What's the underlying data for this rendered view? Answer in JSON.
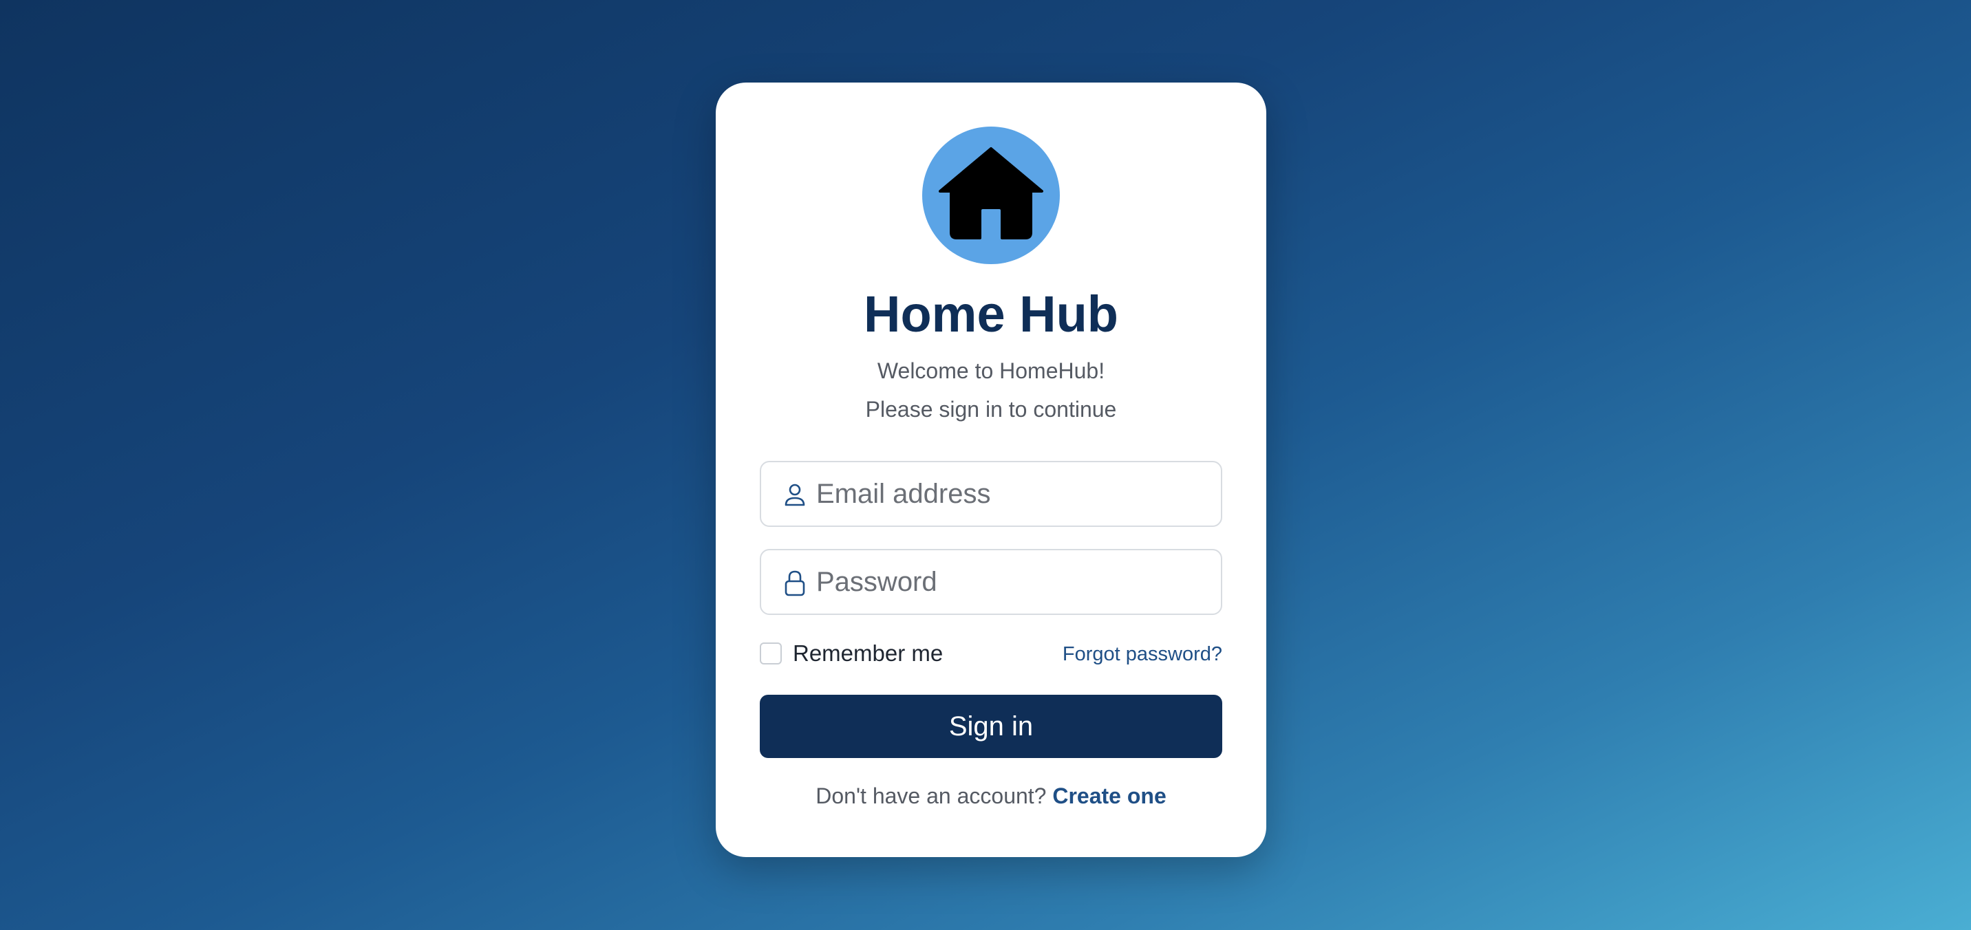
{
  "app": {
    "title": "Home Hub",
    "welcome": "Welcome to HomeHub!",
    "subtitle": "Please sign in to continue",
    "logo_icon": "house-icon",
    "logo_bg_color": "#5ba4e6"
  },
  "form": {
    "email": {
      "icon": "user-icon",
      "placeholder": "Email address",
      "value": ""
    },
    "password": {
      "icon": "lock-icon",
      "placeholder": "Password",
      "value": ""
    },
    "remember_label": "Remember me",
    "remember_checked": false,
    "forgot_label": "Forgot password?",
    "submit_label": "Sign in"
  },
  "footer": {
    "prompt": "Don't have an account?",
    "link_label": "Create one"
  },
  "colors": {
    "primary": "#0f2e57",
    "link": "#1f4f86",
    "accent": "#5ba4e6"
  }
}
